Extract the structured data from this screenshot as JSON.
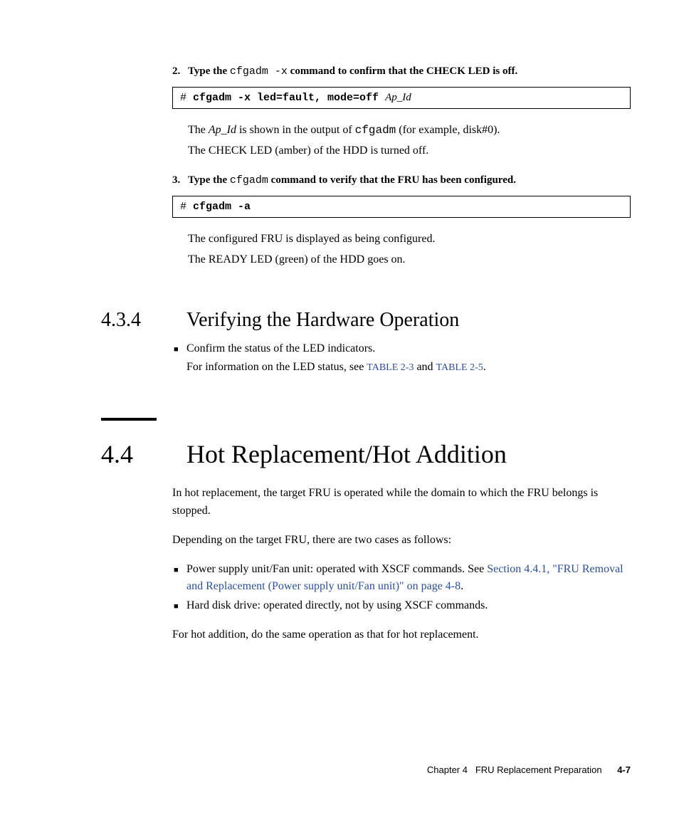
{
  "step2": {
    "num": "2.",
    "pre": "Type the ",
    "mono": "cfgadm -x",
    "post": " command to confirm that the CHECK LED is off."
  },
  "code1": {
    "prompt": "# ",
    "cmd": "cfgadm -x led=fault, mode=off ",
    "arg": "Ap_Id"
  },
  "p1a_pre": "The ",
  "p1a_ital": "Ap_Id",
  "p1a_mid": " is shown in the output of ",
  "p1a_mono": "cfgadm",
  "p1a_post": " (for example, disk#0).",
  "p1b": "The CHECK LED (amber) of the HDD is turned off.",
  "step3": {
    "num": "3.",
    "pre": "Type the ",
    "mono": "cfgadm",
    "post": " command to verify that the FRU has been configured."
  },
  "code2": {
    "prompt": "# ",
    "cmd": "cfgadm -a"
  },
  "p2a": "The configured FRU is displayed as being configured.",
  "p2b": "The READY LED (green) of the HDD goes on.",
  "sec434": {
    "num": "4.3.4",
    "title": "Verifying the Hardware Operation"
  },
  "b434a": "Confirm the status of the LED indicators.",
  "b434b_pre": "For information on the LED status, see ",
  "b434b_ref1": "TABLE 2-3",
  "b434b_mid": " and ",
  "b434b_ref2": "TABLE 2-5",
  "b434b_post": ".",
  "sec44": {
    "num": "4.4",
    "title": "Hot Replacement/Hot Addition"
  },
  "p44a": "In hot replacement, the target FRU is operated while the domain to which the FRU belongs is stopped.",
  "p44b": "Depending on the target FRU, there are two cases as follows:",
  "b44a_pre": "Power supply unit/Fan unit: operated with XSCF commands. See ",
  "b44a_ref": "Section 4.4.1, \"FRU Removal and Replacement (Power supply unit/Fan unit)\" on page 4-8",
  "b44a_post": ".",
  "b44b": "Hard disk drive: operated directly, not by using XSCF commands.",
  "p44c": "For hot addition, do the same operation as that for hot replacement.",
  "footer": {
    "chapter": "Chapter 4",
    "title": "FRU Replacement Preparation",
    "page": "4-7"
  }
}
